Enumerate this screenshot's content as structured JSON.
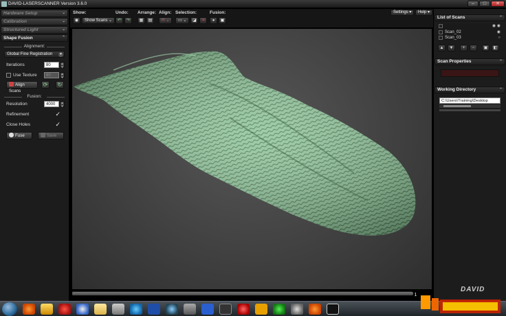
{
  "window": {
    "title": "DAVID-LASERSCANNER Version 3.6.0"
  },
  "left_panel": {
    "sections": [
      {
        "label": "Hardware Setup"
      },
      {
        "label": "Calibration"
      },
      {
        "label": "Structured Light"
      }
    ],
    "active_section": "Shape Fusion",
    "alignment": {
      "group_label": "Alignment:",
      "method": "Global Fine Registration",
      "iterations_label": "Iterations",
      "iterations_value": "80",
      "use_texture_label": "Use Texture",
      "use_texture_value": "80",
      "align_button": "Align Scans"
    },
    "fusion": {
      "group_label": "Fusion:",
      "resolution_label": "Resolution",
      "resolution_value": "4000",
      "refinement_label": "Refinement",
      "close_holes_label": "Close Holes",
      "fuse_button": "Fuse",
      "save_button": "Save"
    }
  },
  "toolbar": {
    "show_label": "Show:",
    "show_value": "Show Scans",
    "undo_label": "Undo:",
    "arrange_label": "Arrange:",
    "align_label": "Align:",
    "selection_label": "Selection:",
    "fusion_label": "Fusion:"
  },
  "top_right": {
    "settings": "Settings",
    "help": "Help"
  },
  "right_panel": {
    "list_title": "List of Scans",
    "scans": [
      "Scan_02",
      "Scan_03"
    ],
    "properties_title": "Scan Properties",
    "working_dir_title": "Working Directory",
    "working_dir_value": "C:\\Users\\Training\\Desktop"
  },
  "viewport": {
    "page_indicator": "1"
  },
  "colors": {
    "scan": "#8fc59a",
    "panel": "#1c1c1c",
    "viewport": "#454545"
  },
  "watermark": {
    "brand": "DAVID"
  }
}
